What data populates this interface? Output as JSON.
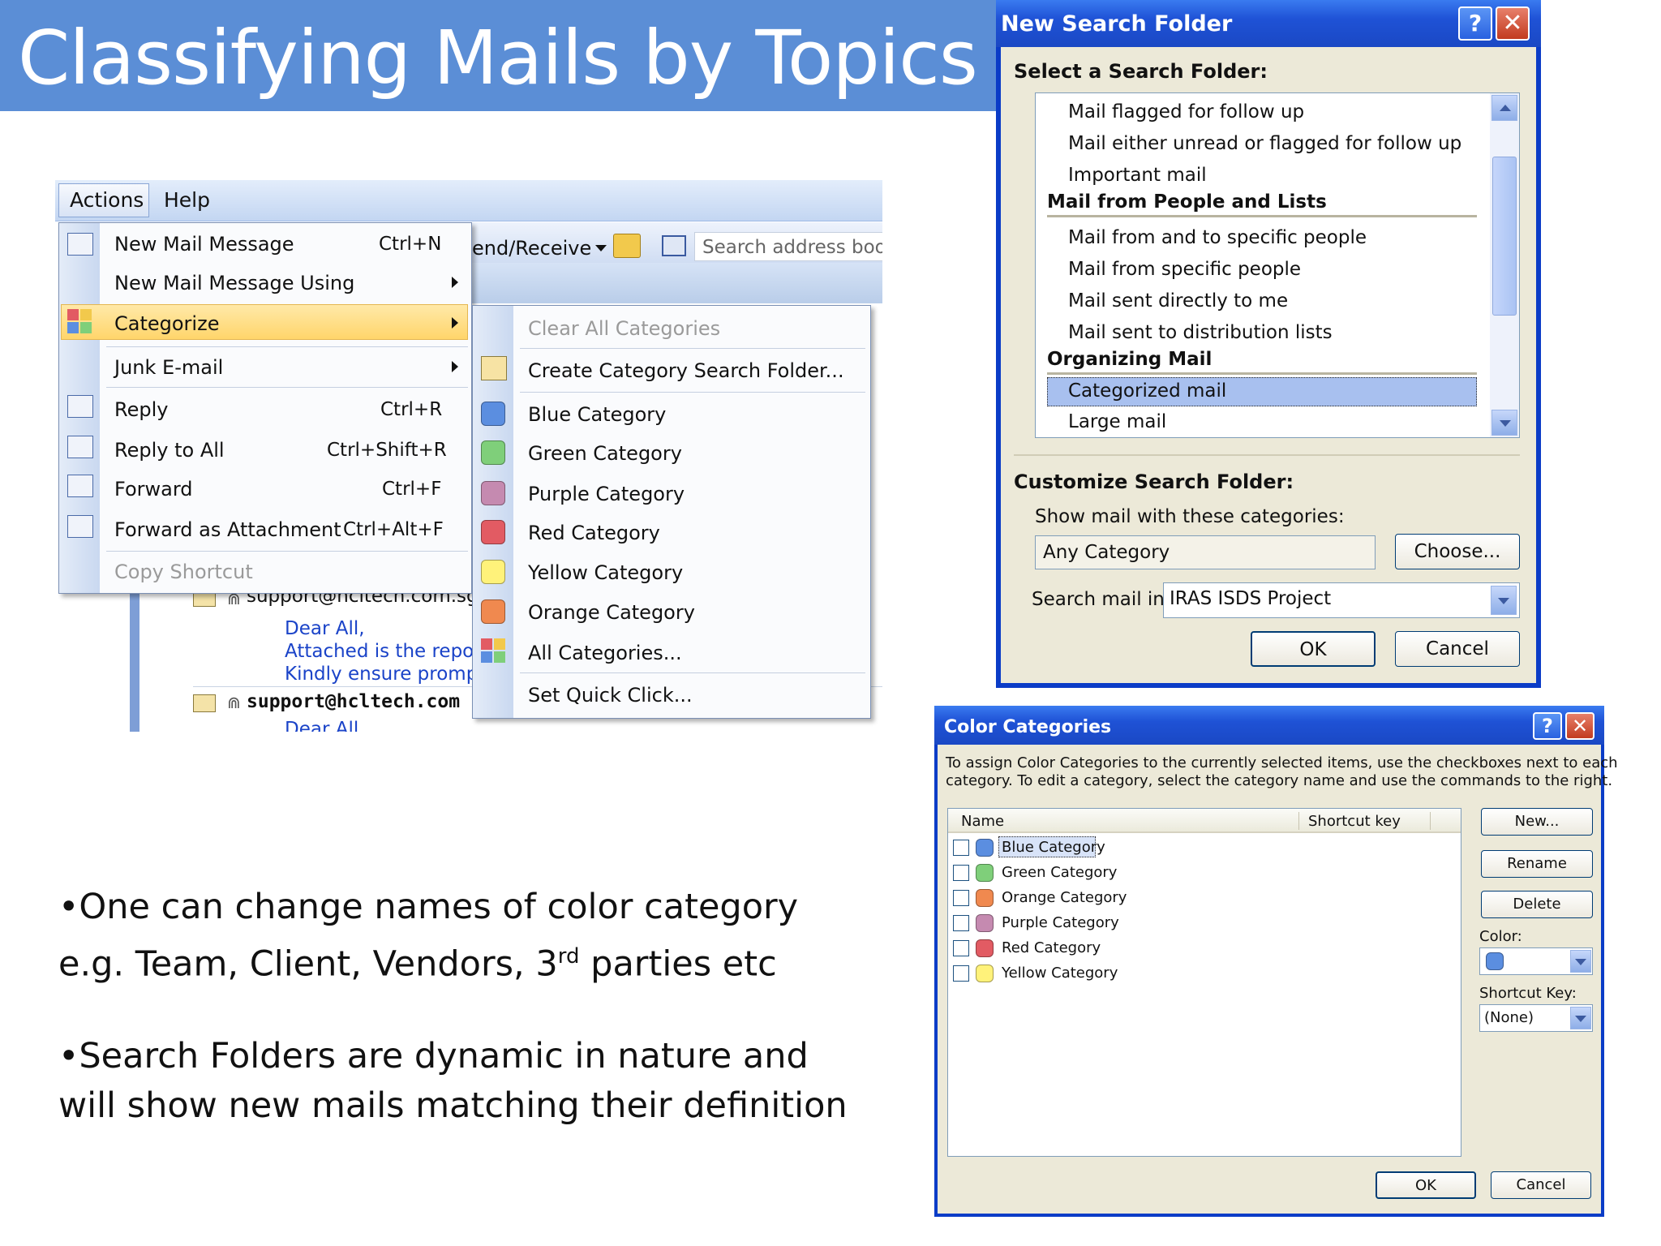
{
  "slide": {
    "title": "Classifying Mails by Topics",
    "bullet1_line1": "•One can change names of color category",
    "bullet1_line2_a": "e.g. Team, Client, Vendors, 3",
    "bullet1_sup": "rd",
    "bullet1_line2_b": " parties etc",
    "bullet2_line1": "•Search Folders are dynamic in nature and",
    "bullet2_line2": "will show new mails matching their definition"
  },
  "outlook": {
    "menubar": {
      "actions": "Actions",
      "help": "Help"
    },
    "toolbar": {
      "send_receive": "end/Receive",
      "search_placeholder": "Search address books"
    },
    "mail": {
      "sender1": "support@hcltech.com.sg",
      "line1": "Dear All,",
      "line2": "Attached is the repor",
      "line3": "Kindly ensure prompt",
      "sender2": "support@hcltech.com",
      "line4": "Dear All"
    },
    "actions_menu": [
      {
        "label": "New Mail Message",
        "shortcut": "Ctrl+N",
        "icon": "new-mail-icon"
      },
      {
        "label": "New Mail Message Using",
        "shortcut": "",
        "icon": ""
      },
      {
        "label": "Categorize",
        "shortcut": "",
        "icon": "categorize-icon"
      },
      {
        "label": "Junk E-mail",
        "shortcut": "",
        "icon": ""
      },
      {
        "label": "Reply",
        "shortcut": "Ctrl+R",
        "icon": "reply-icon"
      },
      {
        "label": "Reply to All",
        "shortcut": "Ctrl+Shift+R",
        "icon": "reply-all-icon"
      },
      {
        "label": "Forward",
        "shortcut": "Ctrl+F",
        "icon": "forward-icon"
      },
      {
        "label": "Forward as Attachment",
        "shortcut": "Ctrl+Alt+F",
        "icon": "forward-attachment-icon"
      },
      {
        "label": "Copy Shortcut",
        "shortcut": "",
        "icon": ""
      }
    ],
    "categorize_menu": [
      {
        "label": "Clear All Categories"
      },
      {
        "label": "Create Category Search Folder..."
      },
      {
        "label": "Blue Category",
        "color": "#5b8ee0"
      },
      {
        "label": "Green Category",
        "color": "#7fcf7a"
      },
      {
        "label": "Purple Category",
        "color": "#c58ab0"
      },
      {
        "label": "Red Category",
        "color": "#e25b63"
      },
      {
        "label": "Yellow Category",
        "color": "#fff27a"
      },
      {
        "label": "Orange Category",
        "color": "#f0894f"
      },
      {
        "label": "All Categories..."
      },
      {
        "label": "Set Quick Click..."
      }
    ]
  },
  "search_folder_dialog": {
    "title": "New Search Folder",
    "select_label": "Select a Search Folder:",
    "list": [
      {
        "text": "Mail flagged for follow up",
        "type": "item"
      },
      {
        "text": "Mail either unread or flagged for follow up",
        "type": "item"
      },
      {
        "text": "Important mail",
        "type": "item"
      },
      {
        "text": "Mail from People and Lists",
        "type": "header"
      },
      {
        "text": "Mail from and to specific people",
        "type": "item"
      },
      {
        "text": "Mail from specific people",
        "type": "item"
      },
      {
        "text": "Mail sent directly to me",
        "type": "item"
      },
      {
        "text": "Mail sent to distribution lists",
        "type": "item"
      },
      {
        "text": "Organizing Mail",
        "type": "header"
      },
      {
        "text": "Categorized mail",
        "type": "selected"
      },
      {
        "text": "Large mail",
        "type": "item"
      }
    ],
    "customize_label": "Customize Search Folder:",
    "show_label": "Show mail with these categories:",
    "category_value": "Any Category",
    "choose_button": "Choose...",
    "search_in_label": "Search mail in:",
    "search_in_value": "IRAS ISDS Project",
    "ok": "OK",
    "cancel": "Cancel"
  },
  "color_categories_dialog": {
    "title": "Color Categories",
    "instructions_line1": "To assign Color Categories to the currently selected items, use the checkboxes next to each",
    "instructions_line2": "category.  To edit a category, select the category name and use the commands to the right.",
    "col_name": "Name",
    "col_shortcut": "Shortcut key",
    "categories": [
      {
        "name": "Blue Category",
        "color": "#5b8ee0"
      },
      {
        "name": "Green Category",
        "color": "#7fcf7a"
      },
      {
        "name": "Orange Category",
        "color": "#f0894f"
      },
      {
        "name": "Purple Category",
        "color": "#c58ab0"
      },
      {
        "name": "Red Category",
        "color": "#e25b63"
      },
      {
        "name": "Yellow Category",
        "color": "#fff27a"
      }
    ],
    "new_button": "New...",
    "rename_button": "Rename",
    "delete_button": "Delete",
    "color_label": "Color:",
    "shortcut_label": "Shortcut Key:",
    "shortcut_value": "(None)",
    "ok": "OK",
    "cancel": "Cancel"
  }
}
